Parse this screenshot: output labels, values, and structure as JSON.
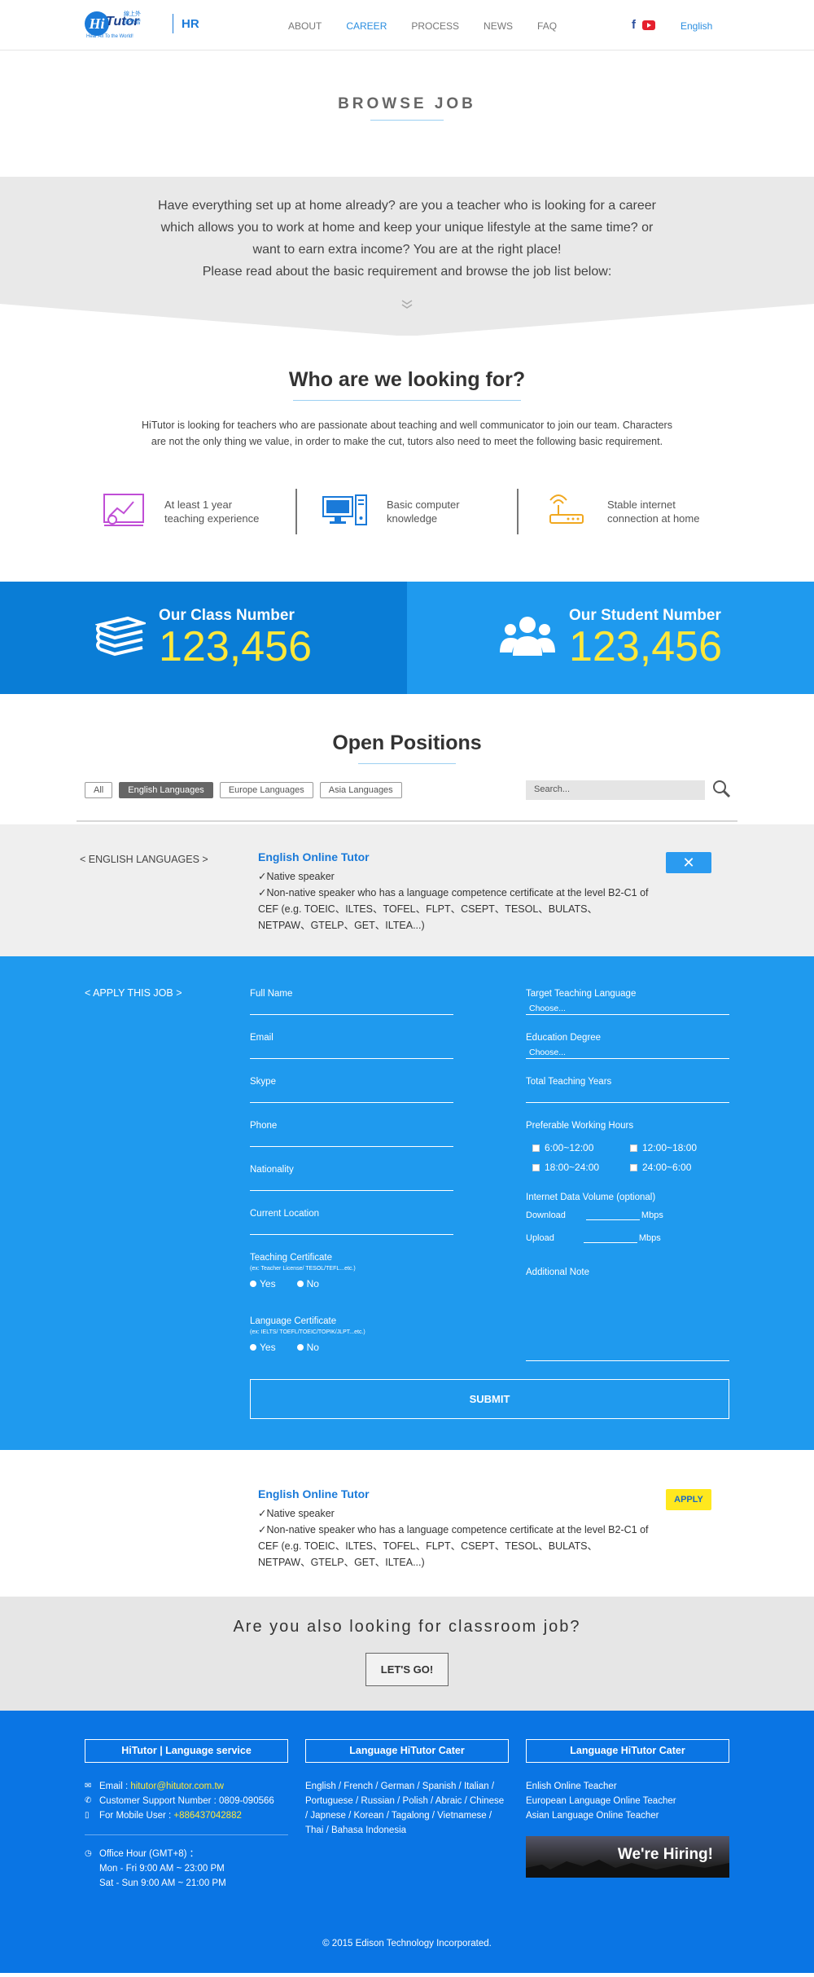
{
  "header": {
    "logo_mark": "Hi",
    "logo_word": "Tutor",
    "logo_sub": "線上外語學習",
    "logo_tag": "Hear All To the World!",
    "section": "HR",
    "nav": [
      "ABOUT",
      "CAREER",
      "PROCESS",
      "NEWS",
      "FAQ"
    ],
    "language": "English"
  },
  "browse": {
    "title": "BROWSE JOB",
    "intro": "Have everything set up at home already? are you a teacher who is looking for a career which allows you to work at home and keep your unique lifestyle at the same time? or want to earn extra income? You are at the right place!",
    "intro2": "Please read about the basic requirement and browse the job list below:"
  },
  "who": {
    "title": "Who are we looking for?",
    "desc": "HiTutor is looking for teachers who are passionate about teaching and well communicator to join our team. Characters are not the only thing we value, in order to make the cut, tutors also need to meet the following basic requirement.",
    "req1a": "At least 1 year",
    "req1b": "teaching experience",
    "req2a": "Basic computer",
    "req2b": "knowledge",
    "req3a": "Stable internet",
    "req3b": "connection at home"
  },
  "stats": {
    "class_label": "Our Class Number",
    "class_value": "123,456",
    "student_label": "Our Student Number",
    "student_value": "123,456"
  },
  "positions": {
    "title": "Open Positions",
    "filters": [
      "All",
      "English Languages",
      "Europe Languages",
      "Asia Languages"
    ],
    "search_placeholder": "Search..."
  },
  "job": {
    "category": "< ENGLISH LANGUAGES >",
    "title": "English Online Tutor",
    "line1": "✓Native speaker",
    "line2": "✓Non-native speaker who has a language competence certificate at the level B2-C1 of CEF (e.g. TOEIC、ILTES、TOFEL、FLPT、CSEPT、TESOL、BULATS、NETPAW、GTELP、GET、ILTEA...)",
    "close": "✕"
  },
  "apply": {
    "category": "< APPLY THIS JOB >",
    "full_name": "Full Name",
    "email": "Email",
    "skype": "Skype",
    "phone": "Phone",
    "nationality": "Nationality",
    "location": "Current Location",
    "teaching_cert": "Teaching Certificate",
    "teaching_cert_sub": "(ex: Teacher License/ TESOL/TEFL...etc.)",
    "lang_cert": "Language Certificate",
    "lang_cert_sub": "(ex: IELTS/ TOEFL/TOEIC/TOPIK/JLPT...etc.)",
    "yes": "Yes",
    "no": "No",
    "target_lang": "Target Teaching Language",
    "choose": "Choose...",
    "education": "Education Degree",
    "total_years": "Total Teaching Years",
    "hours_label": "Preferable Working Hours",
    "hours": [
      "6:00~12:00",
      "12:00~18:00",
      "18:00~24:00",
      "24:00~6:00"
    ],
    "internet": "Internet Data Volume (optional)",
    "download": "Download",
    "upload": "Upload",
    "mbps": "Mbps",
    "note": "Additional Note",
    "submit": "SUBMIT"
  },
  "job2": {
    "title": "English Online Tutor",
    "line1": "✓Native speaker",
    "line2": "✓Non-native speaker who has a language competence certificate at the level B2-C1 of CEF (e.g. TOEIC、ILTES、TOFEL、FLPT、CSEPT、TESOL、BULATS、NETPAW、GTELP、GET、ILTEA...)",
    "apply": "APPLY"
  },
  "classroom": {
    "title": "Are you also looking for classroom job?",
    "button": "LET'S GO!"
  },
  "footer": {
    "col1_title": "HiTutor | Language service",
    "email_label": "Email :",
    "email": "hitutor@hitutor.com.tw",
    "support": "Customer Support Number : 0809-090566",
    "mobile_label": "For Mobile User :",
    "mobile": "+886437042882",
    "office": "Office Hour (GMT+8) ：",
    "weekday": "Mon - Fri    9:00 AM ~ 23:00 PM",
    "weekend": "Sat - Sun    9:00 AM ~ 21:00 PM",
    "col2_title": "Language HiTutor Cater",
    "col2_body": "English / French / German / Spanish / Italian / Portuguese / Russian / Polish / Abraic / Chinese / Japnese / Korean / Tagalong / Vietnamese / Thai / Bahasa Indonesia",
    "col3_title": "Language HiTutor Cater",
    "col3_items": [
      "Enlish Online Teacher",
      "European Language Online Teacher",
      "Asian Language Online Teacher"
    ],
    "hiring": "We're Hiring!",
    "copyright": "© 2015 Edison Technology Incorporated."
  }
}
